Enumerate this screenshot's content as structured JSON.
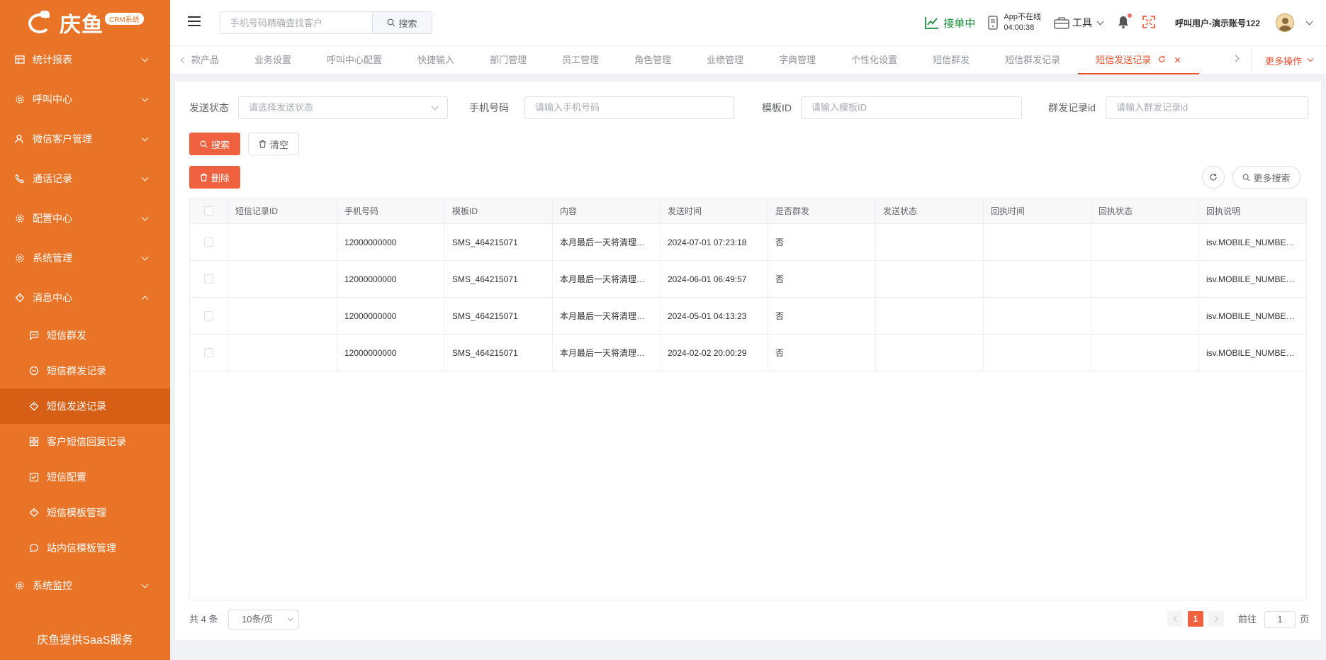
{
  "brand": {
    "name": "庆鱼",
    "badge": "CRM系统"
  },
  "colors": {
    "sidebar": "#e97427",
    "sidebar_active": "#d65e15",
    "primary": "#f0613f",
    "active_tab": "#e94e2b",
    "online": "#1a8f3a"
  },
  "sidebar": {
    "menus_top": [
      {
        "label": "统计报表",
        "icon": "table-icon"
      },
      {
        "label": "呼叫中心",
        "icon": "gear-icon"
      },
      {
        "label": "微信客户管理",
        "icon": "user-icon"
      },
      {
        "label": "通话记录",
        "icon": "phone-icon"
      },
      {
        "label": "配置中心",
        "icon": "gear-icon"
      },
      {
        "label": "系统管理",
        "icon": "gear-icon"
      },
      {
        "label": "消息中心",
        "icon": "tag-icon"
      }
    ],
    "sub_items": [
      {
        "label": "短信群发",
        "icon": "chat-icon"
      },
      {
        "label": "短信群发记录",
        "icon": "minus-circle-icon"
      },
      {
        "label": "短信发送记录",
        "icon": "tag-icon"
      },
      {
        "label": "客户短信回复记录",
        "icon": "grid-icon"
      },
      {
        "label": "短信配置",
        "icon": "checkbox-icon"
      },
      {
        "label": "短信模板管理",
        "icon": "tag-icon"
      },
      {
        "label": "站内信模板管理",
        "icon": "bubble-icon"
      }
    ],
    "menu_bottom": {
      "label": "系统监控",
      "icon": "gear-icon"
    },
    "footer": "庆鱼提供SaaS服务"
  },
  "header": {
    "search_placeholder": "手机号码精确查找客户",
    "search_button": "搜索",
    "status": "接单中",
    "app_status_line1": "App不在线",
    "app_status_line2": "04:00:38",
    "tools": "工具",
    "username": "呼叫用户-演示账号122"
  },
  "tabs": [
    "款产品",
    "业务设置",
    "呼叫中心配置",
    "快捷输入",
    "部门管理",
    "员工管理",
    "角色管理",
    "业绩管理",
    "字典管理",
    "个性化设置",
    "短信群发",
    "短信群发记录",
    "短信发送记录"
  ],
  "more_ops": "更多操作",
  "filters": {
    "status_label": "发送状态",
    "status_placeholder": "请选择发送状态",
    "phone_label": "手机号码",
    "phone_placeholder": "请输入手机号码",
    "template_label": "模板ID",
    "template_placeholder": "请输入模板ID",
    "group_label": "群发记录id",
    "group_placeholder": "请输入群发记录id"
  },
  "buttons": {
    "search": "搜索",
    "clear": "清空",
    "delete": "删除",
    "more_search": "更多搜索"
  },
  "table": {
    "columns": [
      "短信记录ID",
      "手机号码",
      "模板ID",
      "内容",
      "发送时间",
      "是否群发",
      "发送状态",
      "回执时间",
      "回执状态",
      "回执说明"
    ],
    "rows": [
      {
        "id": "",
        "phone": "12000000000",
        "template": "SMS_464215071",
        "content": "本月最后一天将清理…",
        "time": "2024-07-01 07:23:18",
        "group": "否",
        "status": "",
        "receipt_time": "",
        "receipt_status": "",
        "receipt_desc": "isv.MOBILE_NUMBE…"
      },
      {
        "id": "",
        "phone": "12000000000",
        "template": "SMS_464215071",
        "content": "本月最后一天将清理…",
        "time": "2024-06-01 06:49:57",
        "group": "否",
        "status": "",
        "receipt_time": "",
        "receipt_status": "",
        "receipt_desc": "isv.MOBILE_NUMBE…"
      },
      {
        "id": "",
        "phone": "12000000000",
        "template": "SMS_464215071",
        "content": "本月最后一天将清理…",
        "time": "2024-05-01 04:13:23",
        "group": "否",
        "status": "",
        "receipt_time": "",
        "receipt_status": "",
        "receipt_desc": "isv.MOBILE_NUMBE…"
      },
      {
        "id": "",
        "phone": "12000000000",
        "template": "SMS_464215071",
        "content": "本月最后一天将清理…",
        "time": "2024-02-02 20:00:29",
        "group": "否",
        "status": "",
        "receipt_time": "",
        "receipt_status": "",
        "receipt_desc": "isv.MOBILE_NUMBE…"
      }
    ]
  },
  "pagination": {
    "total": "共 4 条",
    "page_size": "10条/页",
    "current": "1",
    "goto_prefix": "前往",
    "goto_value": "1",
    "goto_suffix": "页"
  }
}
